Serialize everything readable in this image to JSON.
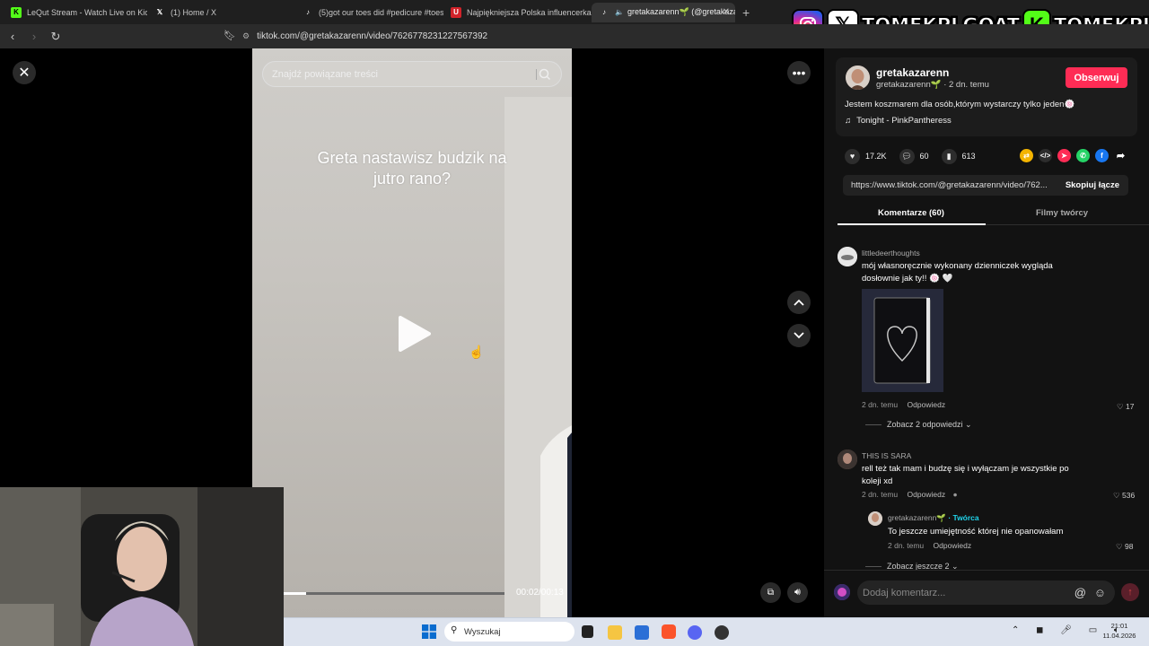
{
  "browser": {
    "tabs": [
      {
        "label": "LeQut Stream - Watch Live on Kick",
        "icon": "kick-icon",
        "color": "#53fc18"
      },
      {
        "label": "(1) Home / X",
        "icon": "x-icon",
        "color": "#ffffff"
      },
      {
        "label": "(5)got our toes did #pedicure #toes",
        "icon": "tiktok-icon",
        "color": "#ffffff"
      },
      {
        "label": "Najpiękniejsza Polska influencerka | U",
        "icon": "u-icon",
        "color": "#d2232a"
      },
      {
        "label": "gretakazarenn🌱 (@gretakazar",
        "icon": "tiktok-icon",
        "color": "#ffffff",
        "active": true
      }
    ],
    "new_tab": "+",
    "address": "tiktok.com/@gretakazarenn/video/7626778231227567392"
  },
  "overlay_brand": {
    "handle1": "TOMEKPLGOAT",
    "handle2": "TOMEKPL",
    "icons": [
      "instagram-icon",
      "x-icon",
      "kick-icon"
    ]
  },
  "video": {
    "search_placeholder": "Znajdź powiązane treści",
    "caption_line1": "Greta nastawisz budzik na",
    "caption_line2": "jutro rano?",
    "time": "00:02/00:13",
    "progress": 0.1
  },
  "author": {
    "name": "gretakazarenn",
    "sub": "gretakazarenn🌱 · 2 dn. temu",
    "follow": "Obserwuj",
    "description": "Jestem koszmarem dla osób,którym wystarczy tylko jeden🍥",
    "music": "Tonight - PinkPantheress"
  },
  "stats": {
    "likes": "17.2K",
    "comments": "60",
    "saves": "613"
  },
  "share": {
    "url": "https://www.tiktok.com/@gretakazarenn/video/762...",
    "copy": "Skopiuj łącze"
  },
  "tabs": {
    "comments": "Komentarze (60)",
    "creator_videos": "Filmy twórcy"
  },
  "comments": [
    {
      "user": "littledeerthoughts",
      "text1": "mój własnoręcznie wykonany dzienniczek wygląda",
      "text2": "dosłownie jak ty!! 🍥 🤍",
      "time": "2 dn. temu",
      "reply": "Odpowiedz",
      "likes": "17",
      "more": "Zobacz 2 odpowiedzi ⌄"
    },
    {
      "user": "THIS IS SARA",
      "text1": "rell też tak mam i budzę się i wyłączam je wszystkie po",
      "text2": "koleji xd",
      "time": "2 dn. temu",
      "reply": "Odpowiedz",
      "likes": "536"
    },
    {
      "user": "gretakazarenn🌱",
      "creator_badge": "· Twórca",
      "text1": "To jeszcze umiejętność której nie opanowałam",
      "time": "2 dn. temu",
      "reply": "Odpowiedz",
      "likes": "98",
      "more": "Zobacz jeszcze 2 ⌄"
    }
  ],
  "comment_input": {
    "placeholder": "Dodaj komentarz..."
  },
  "taskbar": {
    "search": "Wyszukaj",
    "time": "21:01",
    "date": "11.04.2026"
  },
  "colors": {
    "follow": "#fe2c55",
    "creator": "#20d5ec",
    "kick": "#53fc18"
  }
}
